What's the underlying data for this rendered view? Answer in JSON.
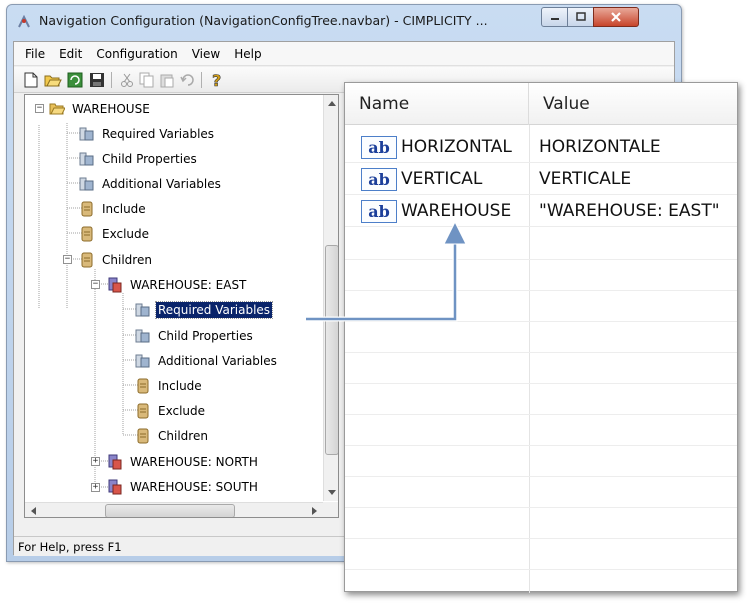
{
  "window": {
    "title": "Navigation Configuration (NavigationConfigTree.navbar) - CIMPLICITY ...",
    "min_icon": "minimize-icon",
    "max_icon": "maximize-icon",
    "close_icon": "close-icon"
  },
  "menu": {
    "items": [
      "File",
      "Edit",
      "Configuration",
      "View",
      "Help"
    ]
  },
  "toolbar": {
    "icons": [
      "new-icon",
      "open-icon",
      "refresh-icon",
      "save-icon",
      "cut-icon",
      "copy-icon",
      "paste-icon",
      "undo-icon",
      "help-icon"
    ]
  },
  "tree": {
    "nodes": [
      {
        "label": "WAREHOUSE",
        "icon": "folder-open-icon"
      },
      {
        "label": "Required Variables",
        "icon": "variables-icon"
      },
      {
        "label": "Child Properties",
        "icon": "variables-icon"
      },
      {
        "label": "Additional Variables",
        "icon": "variables-icon"
      },
      {
        "label": "Include",
        "icon": "filter-icon"
      },
      {
        "label": "Exclude",
        "icon": "filter-icon"
      },
      {
        "label": "Children",
        "icon": "filter-icon"
      },
      {
        "label": "WAREHOUSE: EAST",
        "icon": "warehouse-node-icon"
      },
      {
        "label": "Required Variables",
        "icon": "variables-icon",
        "selected": true
      },
      {
        "label": "Child Properties",
        "icon": "variables-icon"
      },
      {
        "label": "Additional Variables",
        "icon": "variables-icon"
      },
      {
        "label": "Include",
        "icon": "filter-icon"
      },
      {
        "label": "Exclude",
        "icon": "filter-icon"
      },
      {
        "label": "Children",
        "icon": "filter-icon"
      },
      {
        "label": "WAREHOUSE: NORTH",
        "icon": "warehouse-node-icon"
      },
      {
        "label": "WAREHOUSE: SOUTH",
        "icon": "warehouse-node-icon"
      }
    ]
  },
  "status": {
    "text": "For Help, press F1"
  },
  "list": {
    "columns": {
      "name": "Name",
      "value": "Value"
    },
    "rows": [
      {
        "icon_text": "ab",
        "name": "HORIZONTAL",
        "value": "HORIZONTALE"
      },
      {
        "icon_text": "ab",
        "name": "VERTICAL",
        "value": "VERTICALE"
      },
      {
        "icon_text": "ab",
        "name": "WAREHOUSE",
        "value": "\"WAREHOUSE: EAST\""
      }
    ]
  },
  "colors": {
    "selection": "#0a246a",
    "arrow": "#6f93c3"
  }
}
